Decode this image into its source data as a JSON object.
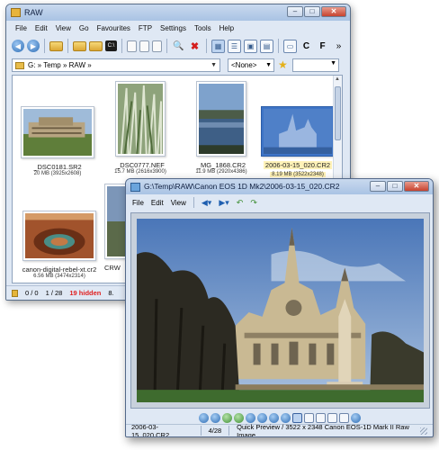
{
  "browser": {
    "title": "RAW",
    "window_buttons": [
      "–",
      "□",
      "✕"
    ],
    "menu": [
      "File",
      "Edit",
      "View",
      "Go",
      "Favourites",
      "FTP",
      "Settings",
      "Tools",
      "Help"
    ],
    "toolbar_overflow": "»",
    "path": "G: » Temp » RAW »",
    "filter": "<None>",
    "thumbnails": [
      {
        "name": "_DSC0181.SR2",
        "info": "20 MB (3925x2608)",
        "selected": false
      },
      {
        "name": "_DSC0777.NEF",
        "info": "15.7 MB (2616x3900)",
        "selected": false
      },
      {
        "name": "_MG_1868.CR2",
        "info": "11.9 MB (2920x4386)",
        "selected": false
      },
      {
        "name": "2006-03-15_020.CR2",
        "info": "8.19 MB (3522x2348)",
        "selected": true
      },
      {
        "name": "canon-digital-rebel-xt.cr2",
        "info": "6.56 MB (3474x2314)",
        "selected": false
      },
      {
        "name": "CRW",
        "info": "",
        "selected": false
      }
    ],
    "status": {
      "count": "0 / 0",
      "page": "1 / 28",
      "hidden": "19 hidden",
      "trailing": "8."
    }
  },
  "viewer": {
    "title": "G:\\Temp\\RAW\\Canon EOS 1D Mk2\\2006-03-15_020.CR2",
    "window_buttons": [
      "–",
      "□",
      "✕"
    ],
    "menu": [
      "File",
      "Edit",
      "View"
    ],
    "status": {
      "filename": "2006-03-15_020.CR2",
      "position": "4/28",
      "info": "Quick Preview / 3522 x 2348 Canon EOS-1D Mark II Raw Image"
    }
  }
}
